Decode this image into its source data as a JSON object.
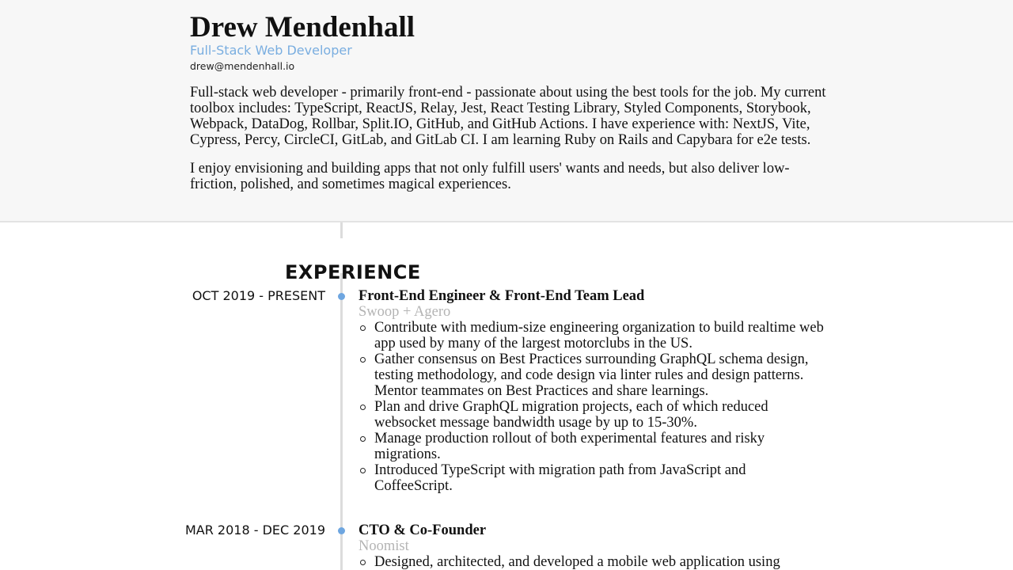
{
  "header": {
    "name": "Drew Mendenhall",
    "subtitle": "Full-Stack Web Developer",
    "email": "drew@mendenhall.io",
    "summary": [
      "Full-stack web developer - primarily front-end - passionate about using the best tools for the job. My current toolbox includes: TypeScript, ReactJS, Relay, Jest, React Testing Library, Styled Components, Storybook, Webpack, DataDog, Rollbar, Split.IO, GitHub, and GitHub Actions. I have experience with: NextJS, Vite, Cypress, Percy, CircleCI, GitLab, and GitLab CI. I am learning Ruby on Rails and Capybara for e2e tests.",
      "I enjoy envisioning and building apps that not only fulfill users' wants and needs, but also deliver low-friction, polished, and sometimes magical experiences."
    ]
  },
  "experience": {
    "title": "EXPERIENCE",
    "jobs": [
      {
        "dates": "OCT 2019 - PRESENT",
        "title": "Front-End Engineer & Front-End Team Lead",
        "company": "Swoop + Agero",
        "bullets": [
          "Contribute with medium-size engineering organization to build realtime web app used by many of the largest motorclubs in the US.",
          "Gather consensus on Best Practices surrounding GraphQL schema design, testing methodology, and code design via linter rules and design patterns. Mentor teammates on Best Practices and share learnings.",
          "Plan and drive GraphQL migration projects, each of which reduced websocket message bandwidth usage by up to 15-30%.",
          "Manage production rollout of both experimental features and risky migrations.",
          "Introduced TypeScript with migration path from JavaScript and CoffeeScript."
        ]
      },
      {
        "dates": "MAR 2018 - DEC 2019",
        "title": "CTO & Co-Founder",
        "company": "Noomist",
        "bullets": [
          "Designed, architected, and developed a mobile web application using"
        ]
      }
    ]
  },
  "colors": {
    "accent": "#7aaee0",
    "dot": "#6ea6e0",
    "company": "#b4b4b4",
    "header_bg": "#f7f7f7",
    "timeline": "#dcdcdc"
  }
}
